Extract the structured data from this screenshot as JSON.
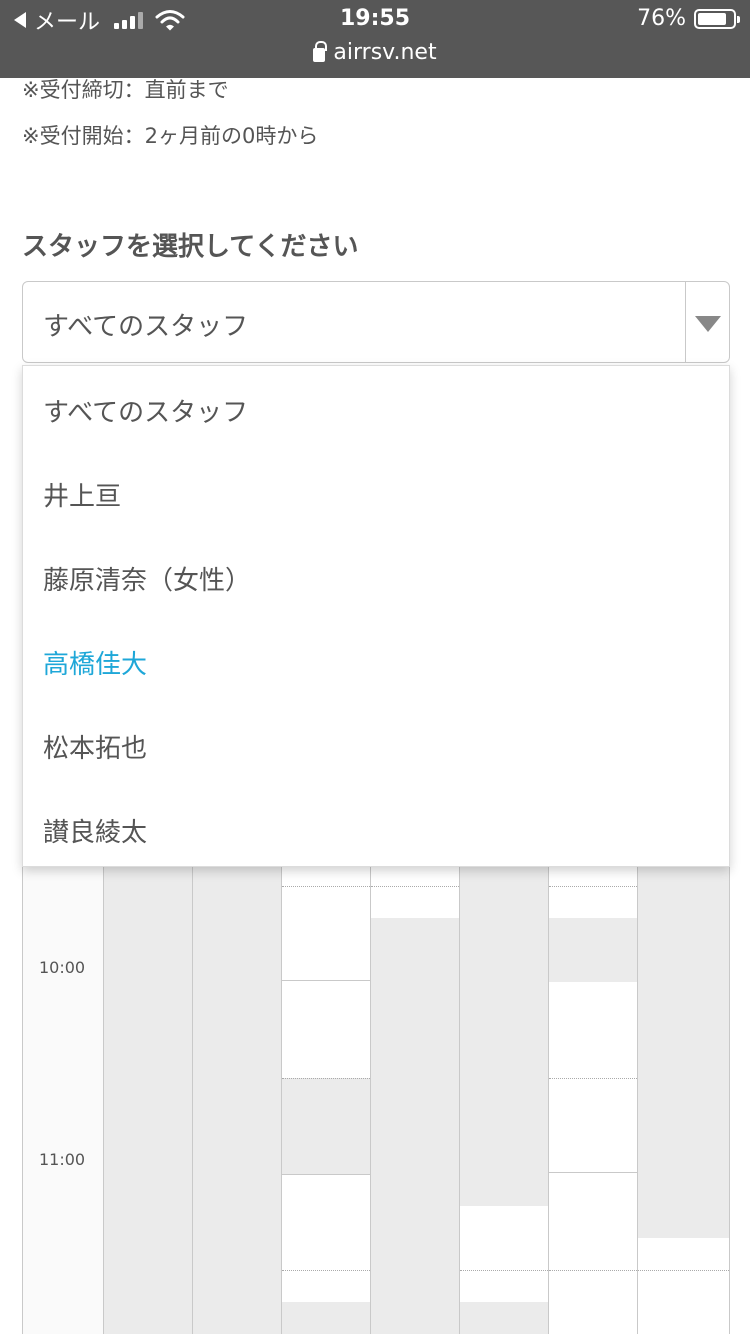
{
  "status_bar": {
    "back_app": "メール",
    "time": "19:55",
    "battery": "76%",
    "url": "airrsv.net",
    "icons": [
      "back-arrow-icon",
      "signal-icon",
      "wifi-icon",
      "battery-icon",
      "lock-icon"
    ]
  },
  "notes": {
    "deadline": "※受付締切：直前まで",
    "start": "※受付開始：2ヶ月前の0時から"
  },
  "staff_select": {
    "label": "スタッフを選択してください",
    "current_value": "すべてのスタッフ",
    "options": [
      "すべてのスタッフ",
      "井上亘",
      "藤原清奈（女性）",
      "高橋佳大",
      "松本拓也",
      "讃良綾太"
    ],
    "highlighted_option": "高橋佳大"
  },
  "calendar": {
    "time_labels": [
      "10:00",
      "11:00"
    ]
  },
  "colors": {
    "accent": "#1ea7d8",
    "status_bar_bg": "#575757",
    "unavailable": "#ebebeb"
  }
}
